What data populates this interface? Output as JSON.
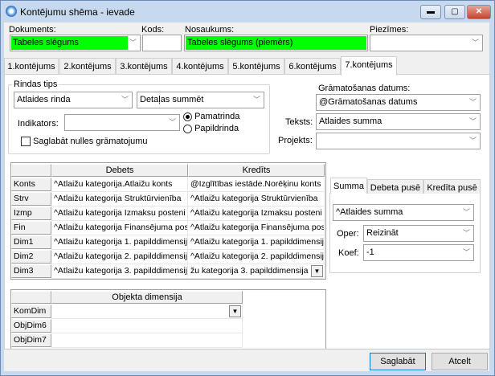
{
  "window": {
    "title": "Kontējumu shēma - ievade",
    "minimize": "▬",
    "maximize": "▢",
    "close": "✕"
  },
  "header": {
    "dokuments_label": "Dokuments:",
    "dokuments_value": "Tabeles slēgums",
    "kods_label": "Kods:",
    "kods_value": "",
    "nosaukums_label": "Nosaukums:",
    "nosaukums_value": "Tabeles slēgums (piemērs)",
    "piezimes_label": "Piezīmes:",
    "piezimes_value": ""
  },
  "tabs": [
    "1.kontējums",
    "2.kontējums",
    "3.kontējums",
    "4.kontējums",
    "5.kontējums",
    "6.kontējums",
    "7.kontējums"
  ],
  "rindas": {
    "group_label": "Rindas tips",
    "tips": "Atlaides rinda",
    "detalas": "Detaļas summēt",
    "indikators_label": "Indikators:",
    "indikators_value": "",
    "radio1": "Pamatrinda",
    "radio2": "Papildrinda",
    "checkbox": "Saglabāt nulles grāmatojumu"
  },
  "right": {
    "datums_label": "Grāmatošanas datums:",
    "datums_value": "@Grāmatošanas datums",
    "teksts_label": "Teksts:",
    "teksts_value": "Atlaides summa",
    "projekts_label": "Projekts:",
    "projekts_value": ""
  },
  "grid": {
    "headers": [
      "Debets",
      "Kredīts"
    ],
    "rows": [
      {
        "label": "Konts",
        "debets": "^Atlaižu kategorija.Atlaižu konts",
        "kredits": "@Izglītības iestāde.Norēķinu konts"
      },
      {
        "label": "Strv",
        "debets": "^Atlaižu kategorija Struktūrvienība",
        "kredits": "^Atlaižu kategorija Struktūrvienība"
      },
      {
        "label": "Izmp",
        "debets": "^Atlaižu kategorija Izmaksu posteni",
        "kredits": "^Atlaižu kategorija Izmaksu posteni"
      },
      {
        "label": "Fin",
        "debets": "^Atlaižu kategorija Finansējuma pos",
        "kredits": "^Atlaižu kategorija Finansējuma pos"
      },
      {
        "label": "Dim1",
        "debets": "^Atlaižu kategorija 1. papilddimensij",
        "kredits": "^Atlaižu kategorija 1. papilddimensij"
      },
      {
        "label": "Dim2",
        "debets": "^Atlaižu kategorija 2. papilddimensij",
        "kredits": "^Atlaižu kategorija 2. papilddimensij"
      },
      {
        "label": "Dim3",
        "debets": "^Atlaižu kategorija 3. papilddimensij",
        "kredits": "žu kategorija 3. papilddimensija"
      }
    ]
  },
  "summa": {
    "tabs": [
      "Summa",
      "Debeta pusē",
      "Kredīta pusē"
    ],
    "value": "^Atlaides summa",
    "oper_label": "Oper:",
    "oper_value": "Reizināt",
    "koef_label": "Koef:",
    "koef_value": "-1"
  },
  "objgrid": {
    "header": "Objekta dimensija",
    "rows": [
      {
        "label": "KomDim",
        "value": ""
      },
      {
        "label": "ObjDim6",
        "value": ""
      },
      {
        "label": "ObjDim7",
        "value": ""
      }
    ]
  },
  "buttons": {
    "save": "Saglabāt",
    "cancel": "Atcelt"
  }
}
